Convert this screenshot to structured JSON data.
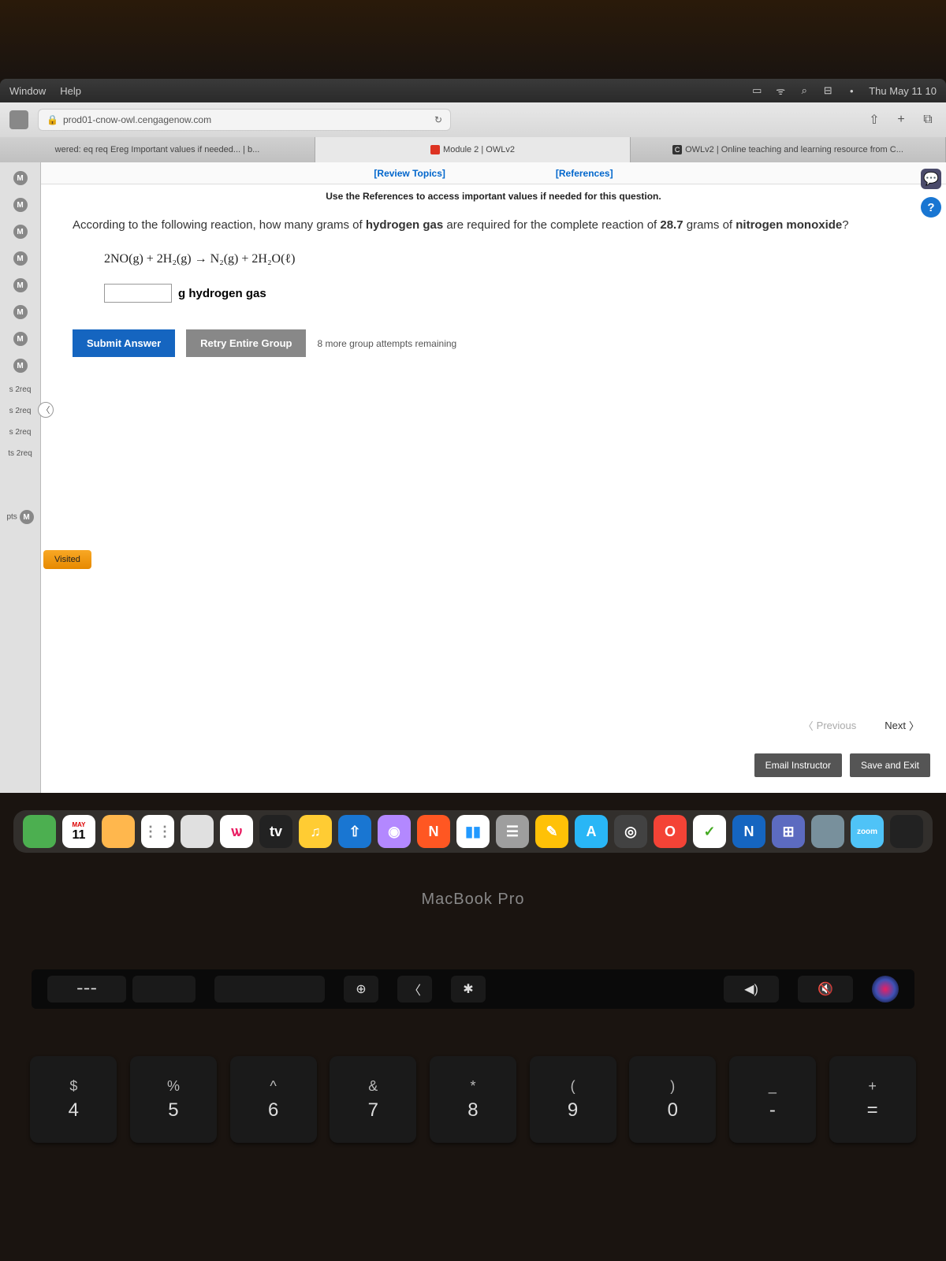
{
  "menubar": {
    "items": [
      "Window",
      "Help"
    ],
    "clock": "Thu May 11 10"
  },
  "browser": {
    "url": "prod01-cnow-owl.cengagenow.com",
    "tabs": [
      {
        "label": "wered: eq req Ereg Important values if needed... | b...",
        "active": false
      },
      {
        "label": "Module 2 | OWLv2",
        "active": true,
        "icon": "#d32"
      },
      {
        "label": "OWLv2 | Online teaching and learning resource from C...",
        "active": false,
        "icon": "#333"
      }
    ]
  },
  "sidebar": {
    "m_items": [
      "M",
      "M",
      "M",
      "M",
      "M",
      "M",
      "M",
      "M"
    ],
    "req_items": [
      "s 2req",
      "s 2req",
      "s 2req",
      "ts 2req"
    ],
    "pts": "pts",
    "visited": "Visited"
  },
  "page": {
    "review": "[Review Topics]",
    "references": "[References]",
    "instr": "Use the References to access important values if needed for this question.",
    "q1": "According to the following reaction, how many grams of ",
    "q1b": "hydrogen gas",
    "q1c": " are required for the complete reaction of ",
    "q1d": "28.7",
    "q1e": " grams of ",
    "q1f": "nitrogen monoxide",
    "q1g": "?",
    "equation": "2NO(g) + 2H₂(g) → N₂(g) + 2H₂O(ℓ)",
    "unit": "g hydrogen gas",
    "submit": "Submit Answer",
    "retry": "Retry Entire Group",
    "attempts": "8 more group attempts remaining",
    "prev": "Previous",
    "next": "Next",
    "email": "Email Instructor",
    "save": "Save and Exit"
  },
  "dock": {
    "cal_month": "MAY",
    "cal_day": "11",
    "icons": [
      {
        "bg": "#4caf50",
        "t": ""
      },
      {
        "bg": "#fff",
        "t": "11",
        "fg": "#000"
      },
      {
        "bg": "#ffb74d",
        "t": ""
      },
      {
        "bg": "#fff",
        "t": "⋮⋮",
        "fg": "#888"
      },
      {
        "bg": "#e0e0e0",
        "t": ""
      },
      {
        "bg": "#fff",
        "t": "ѡ",
        "fg": "#e91e63"
      },
      {
        "bg": "#222",
        "t": "tv"
      },
      {
        "bg": "#fc3",
        "t": "♫",
        "fg": "#fff"
      },
      {
        "bg": "#1976d2",
        "t": "⇧"
      },
      {
        "bg": "#b388ff",
        "t": "◉"
      },
      {
        "bg": "#ff5722",
        "t": "N"
      },
      {
        "bg": "#fff",
        "t": "▮▮",
        "fg": "#29f"
      },
      {
        "bg": "#9e9e9e",
        "t": "☰"
      },
      {
        "bg": "#ffc107",
        "t": "✎"
      },
      {
        "bg": "#29b6f6",
        "t": "A"
      },
      {
        "bg": "#424242",
        "t": "◎"
      },
      {
        "bg": "#f44336",
        "t": "O"
      },
      {
        "bg": "#fff",
        "t": "✓",
        "fg": "#4a2"
      },
      {
        "bg": "#1565c0",
        "t": "N"
      },
      {
        "bg": "#5c6bc0",
        "t": "⊞"
      },
      {
        "bg": "#78909c",
        "t": ""
      },
      {
        "bg": "#4fc3f7",
        "t": "zoom"
      },
      {
        "bg": "#222",
        "t": ""
      }
    ]
  },
  "laptop": "MacBook Pro",
  "touchbar": {
    "icons": [
      "⊕",
      "〈",
      "✱",
      "◀)",
      "🔇"
    ]
  },
  "keys": [
    {
      "top": "$",
      "bot": "4"
    },
    {
      "top": "%",
      "bot": "5"
    },
    {
      "top": "^",
      "bot": "6"
    },
    {
      "top": "&",
      "bot": "7"
    },
    {
      "top": "*",
      "bot": "8"
    },
    {
      "top": "(",
      "bot": "9"
    },
    {
      "top": ")",
      "bot": "0"
    },
    {
      "top": "_",
      "bot": "-"
    },
    {
      "top": "+",
      "bot": "="
    }
  ]
}
